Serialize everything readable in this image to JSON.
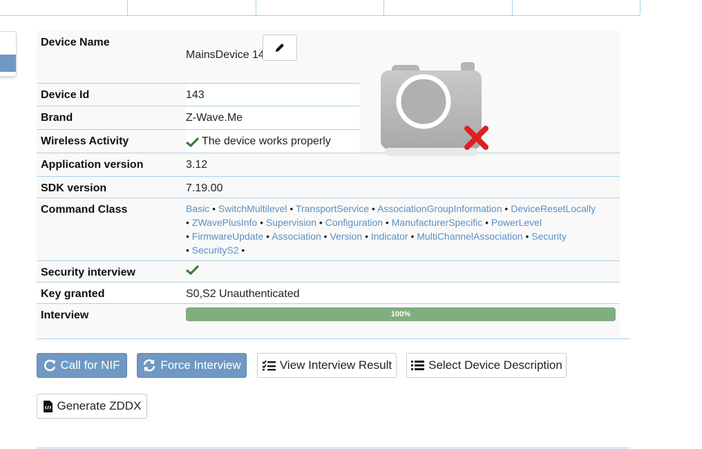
{
  "device": {
    "rows": [
      {
        "label": "Device Name",
        "value": "MainsDevice 143"
      },
      {
        "label": "Device Id",
        "value": "143"
      },
      {
        "label": "Brand",
        "value": "Z-Wave.Me"
      },
      {
        "label": "Wireless Activity",
        "value": "The device works properly"
      },
      {
        "label": "Application version",
        "value": "3.12"
      },
      {
        "label": "SDK version",
        "value": "7.19.00"
      },
      {
        "label": "Command Class",
        "value": ""
      },
      {
        "label": "Security interview",
        "value": ""
      },
      {
        "label": "Key granted",
        "value": "S0,S2 Unauthenticated"
      },
      {
        "label": "Interview",
        "value": ""
      }
    ],
    "command_classes": [
      "Basic",
      "SwitchMultilevel",
      "TransportService",
      "AssociationGroupInformation",
      "DeviceResetLocally",
      "ZWavePlusInfo",
      "Supervision",
      "Configuration",
      "ManufacturerSpecific",
      "PowerLevel",
      "FirmwareUpdate",
      "Association",
      "Version",
      "Indicator",
      "MultiChannelAssociation",
      "Security",
      "SecurityS2"
    ],
    "interview_progress_label": "100%",
    "interview_progress": 1.0
  },
  "buttons": {
    "call_nif": "Call for NIF",
    "force_interview": "Force Interview",
    "view_interview_result": "View Interview Result",
    "select_device_description": "Select Device Description",
    "generate_zddx": "Generate ZDDX"
  },
  "icons": {
    "edit": "pencil-icon",
    "ok": "checkmark-icon",
    "camera": "camera-missing-icon"
  },
  "colors": {
    "accent": "#6f99c2",
    "link": "#5b8fc4",
    "success": "#3c763d",
    "progress": "#7fae7f",
    "error": "#e02020"
  }
}
